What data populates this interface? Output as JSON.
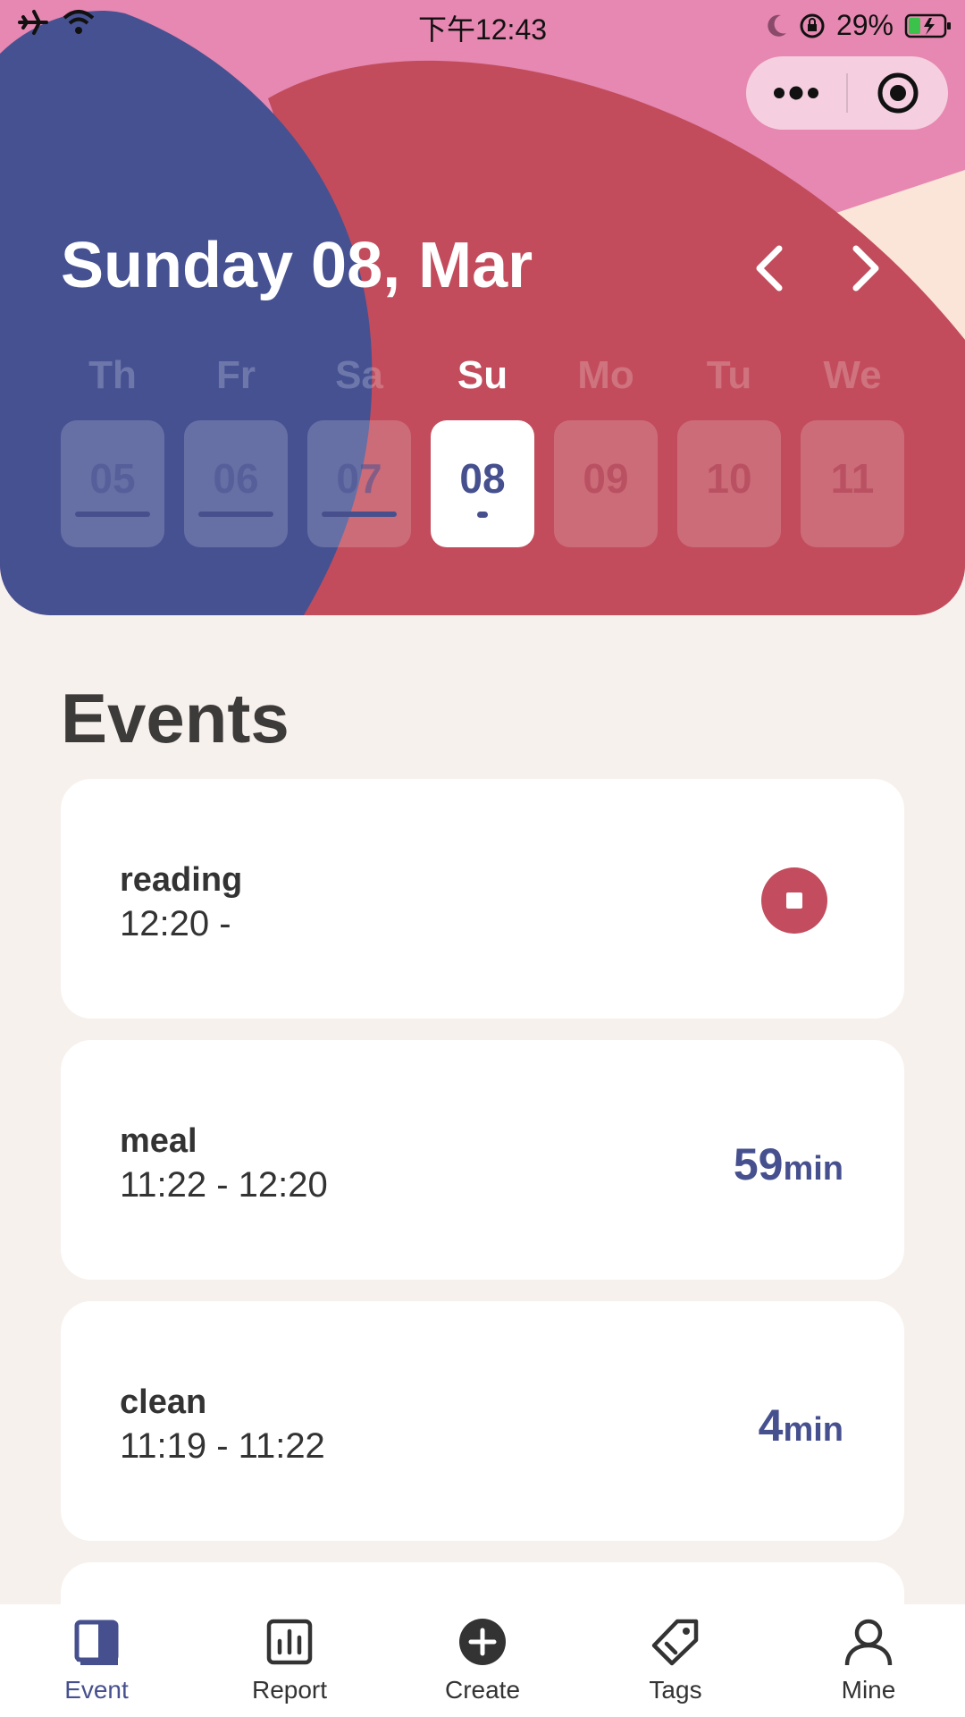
{
  "status_bar": {
    "time": "下午12:43",
    "battery": "29%",
    "icons": [
      "airplane-icon",
      "wifi-icon",
      "moon-icon",
      "orientation-lock-icon",
      "battery-charging-icon"
    ]
  },
  "capsule": {
    "more_icon": "more-dots-icon",
    "close_icon": "target-close-icon"
  },
  "header": {
    "date_title": "Sunday 08, Mar",
    "prev_icon": "chevron-left-icon",
    "next_icon": "chevron-right-icon",
    "colors": {
      "pink": "#e688b1",
      "navy": "#465192",
      "red": "#c24c5c",
      "peach": "#fbe4d8"
    }
  },
  "week": {
    "days": [
      {
        "label": "Th",
        "date": "05"
      },
      {
        "label": "Fr",
        "date": "06"
      },
      {
        "label": "Sa",
        "date": "07"
      },
      {
        "label": "Su",
        "date": "08"
      },
      {
        "label": "Mo",
        "date": "09"
      },
      {
        "label": "Tu",
        "date": "10"
      },
      {
        "label": "We",
        "date": "11"
      }
    ],
    "selected": "08"
  },
  "events": {
    "title": "Events",
    "items": [
      {
        "name": "reading",
        "time": "12:20 -",
        "status": "running"
      },
      {
        "name": "meal",
        "time": "11:22 - 12:20",
        "duration": "59",
        "unit": "min"
      },
      {
        "name": "clean",
        "time": "11:19 - 11:22",
        "duration": "4",
        "unit": "min"
      }
    ]
  },
  "tab_bar": {
    "tabs": [
      {
        "label": "Event",
        "icon": "book-icon",
        "active": true
      },
      {
        "label": "Report",
        "icon": "bar-chart-icon"
      },
      {
        "label": "Create",
        "icon": "plus-circle-icon"
      },
      {
        "label": "Tags",
        "icon": "tag-icon"
      },
      {
        "label": "Mine",
        "icon": "user-icon"
      }
    ]
  }
}
